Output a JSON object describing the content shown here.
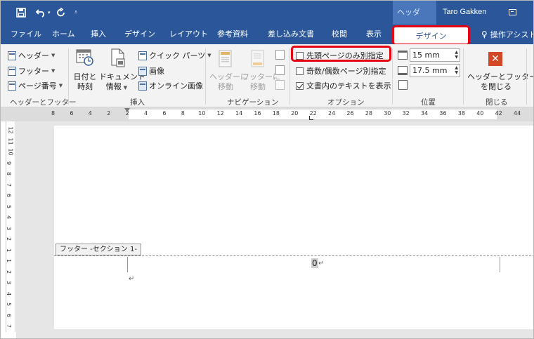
{
  "qat": {
    "save_icon": "save-icon",
    "undo_icon": "undo-icon",
    "redo_icon": "redo-icon",
    "customize_icon": "qat-customize-icon"
  },
  "titlebar": {
    "context_label": "ヘッダー/…",
    "user": "Taro Gakken"
  },
  "tabs": [
    {
      "label": "ファイル"
    },
    {
      "label": "ホーム"
    },
    {
      "label": "挿入"
    },
    {
      "label": "デザイン"
    },
    {
      "label": "レイアウト"
    },
    {
      "label": "参考資料"
    },
    {
      "label": "差し込み文書"
    },
    {
      "label": "校閲"
    },
    {
      "label": "表示"
    }
  ],
  "context_tab": {
    "label": "デザイン"
  },
  "tellme": {
    "label": "操作アシスト"
  },
  "ribbon": {
    "hf": {
      "header": "ヘッダー",
      "footer": "フッター",
      "page_number": "ページ番号",
      "group": "ヘッダーとフッター"
    },
    "insert": {
      "date_l1": "日付と",
      "date_l2": "時刻",
      "doc_l1": "ドキュメント",
      "doc_l2": "情報",
      "quick_parts": "クイック パーツ",
      "picture": "画像",
      "online_picture": "オンライン画像",
      "group": "挿入"
    },
    "nav": {
      "goto_header_l1": "ヘッダーに",
      "goto_header_l2": "移動",
      "goto_footer_l1": "フッターに",
      "goto_footer_l2": "移動",
      "group": "ナビゲーション"
    },
    "options": {
      "first_page": "先頭ページのみ別指定",
      "odd_even": "奇数/偶数ページ別指定",
      "show_text": "文書内のテキストを表示",
      "show_text_checked": true,
      "group": "オプション"
    },
    "position": {
      "header_top": "15 mm",
      "footer_bottom": "17.5 mm",
      "group": "位置"
    },
    "close": {
      "label_l1": "ヘッダーとフッター",
      "label_l2": "を閉じる",
      "group": "閉じる"
    }
  },
  "ruler": {
    "h_numbers": [
      "8",
      "6",
      "4",
      "2",
      "2",
      "4",
      "6",
      "8",
      "10",
      "12",
      "14",
      "16",
      "18",
      "20",
      "22",
      "24",
      "26",
      "28",
      "30",
      "32",
      "34",
      "36",
      "38",
      "40",
      "42",
      "44"
    ],
    "v_numbers": [
      "12",
      "11",
      "10",
      "9",
      "8",
      "7",
      "6",
      "5",
      "4",
      "3",
      "2",
      "1",
      "1",
      "2",
      "3",
      "4",
      "5",
      "6",
      "7"
    ]
  },
  "document": {
    "footer_tag": "フッター -セクション 1-",
    "page_number": "0",
    "return_mark": "↵"
  }
}
